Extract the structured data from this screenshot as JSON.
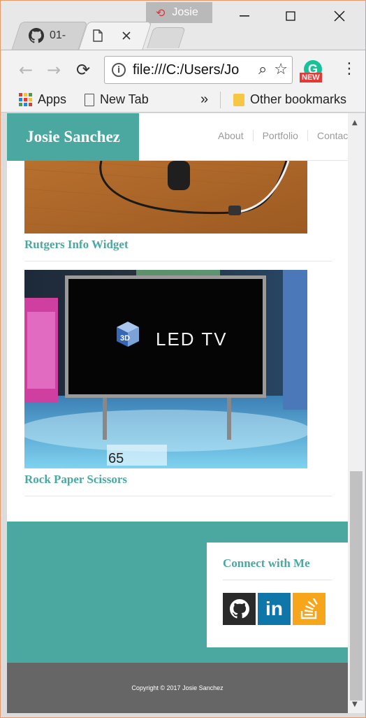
{
  "browser": {
    "profile_name": "Josie",
    "tabs": [
      {
        "label": "01-",
        "icon": "github-icon"
      },
      {
        "label": "",
        "icon": "page-icon",
        "active": true
      }
    ],
    "address": "file:///C:/Users/Jo",
    "extension_badge": "NEW",
    "bookmarks": {
      "apps": "Apps",
      "new_tab": "New Tab",
      "overflow": "»",
      "other": "Other bookmarks"
    }
  },
  "site": {
    "brand": "Josie Sanchez",
    "nav": [
      "About",
      "Portfolio",
      "Contact"
    ],
    "projects": [
      {
        "title": "Rutgers Info Widget",
        "image": "earphones-photo"
      },
      {
        "title": "Rock Paper Scissors",
        "image": "led-tv-photo",
        "image_text": "LED TV",
        "image_badge": "3D",
        "image_number": "65"
      }
    ],
    "connect": {
      "title": "Connect with Me",
      "links": [
        {
          "name": "github",
          "color": "#333333"
        },
        {
          "name": "linkedin",
          "label": "in",
          "color": "#0e76a8"
        },
        {
          "name": "stackoverflow",
          "color": "#f7a51a"
        }
      ]
    },
    "copyright": "Copyright © 2017 Josie Sanchez"
  },
  "colors": {
    "accent": "#4aa8a0",
    "footer_dark": "#666666"
  }
}
